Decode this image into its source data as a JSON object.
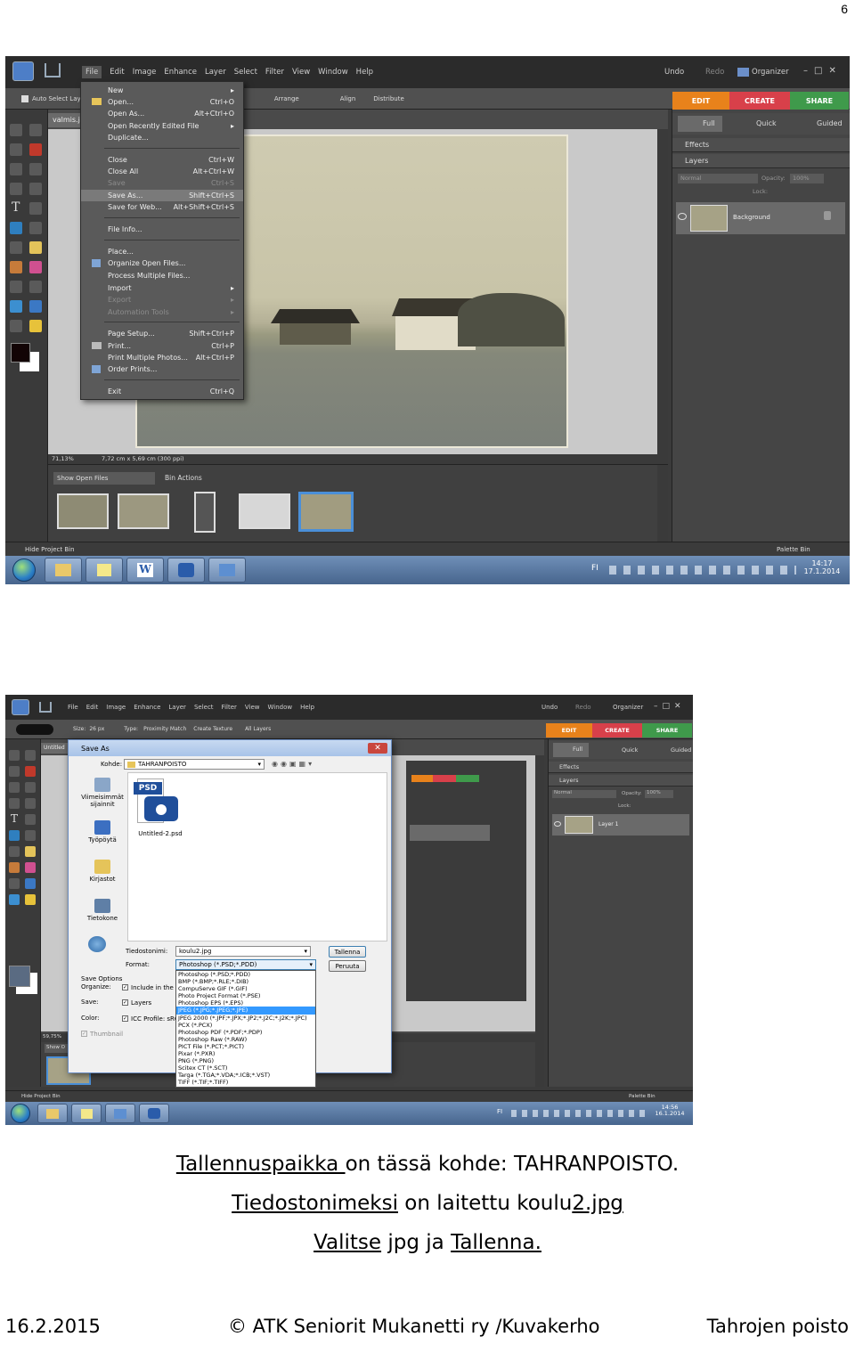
{
  "page_number": "6",
  "colors": {
    "app_bg": "#3b3b3b",
    "edit_tab": "#e8821b",
    "create_tab": "#d8404a",
    "share_tab": "#3f9a4b",
    "highlight": "#3399ff"
  },
  "shot1": {
    "menubar": [
      "File",
      "Edit",
      "Image",
      "Enhance",
      "Layer",
      "Select",
      "Filter",
      "View",
      "Window",
      "Help"
    ],
    "undo": "Undo",
    "redo": "Redo",
    "organizer": "Organizer",
    "options": {
      "auto_select": "Auto Select Layer",
      "arrange": "Arrange",
      "align": "Align",
      "distribute": "Distribute"
    },
    "doc_tab": "valmis.j",
    "tabs": {
      "edit": "EDIT",
      "create": "CREATE",
      "share": "SHARE"
    },
    "subtabs": {
      "full": "Full",
      "quick": "Quick",
      "guided": "Guided"
    },
    "effects": "Effects",
    "layers": "Layers",
    "blend_mode": "Normal",
    "opacity_label": "Opacity:",
    "opacity_value": "100%",
    "lock_label": "Lock:",
    "layer_name": "Background",
    "zoom": "71,13%",
    "doc_info": "7,72 cm x 5,69 cm (300 ppi)",
    "show_open_files": "Show Open Files",
    "bin_actions": "Bin Actions",
    "hide_project_bin": "Hide Project Bin",
    "palette_bin": "Palette Bin",
    "lang": "FI",
    "time": "14:17",
    "date": "17.1.2014",
    "file_menu": [
      {
        "label": "New",
        "shortcut": "",
        "sub": true
      },
      {
        "label": "Open...",
        "shortcut": "Ctrl+O"
      },
      {
        "label": "Open As...",
        "shortcut": "Alt+Ctrl+O"
      },
      {
        "label": "Open Recently Edited File",
        "shortcut": "",
        "sub": true
      },
      {
        "label": "Duplicate...",
        "shortcut": ""
      },
      {
        "label": "Close",
        "shortcut": "Ctrl+W"
      },
      {
        "label": "Close All",
        "shortcut": "Alt+Ctrl+W"
      },
      {
        "label": "Save",
        "shortcut": "Ctrl+S",
        "disabled": true
      },
      {
        "label": "Save As...",
        "shortcut": "Shift+Ctrl+S",
        "highlight": true
      },
      {
        "label": "Save for Web...",
        "shortcut": "Alt+Shift+Ctrl+S"
      },
      {
        "label": "File Info...",
        "shortcut": ""
      },
      {
        "label": "Place...",
        "shortcut": ""
      },
      {
        "label": "Organize Open Files...",
        "shortcut": ""
      },
      {
        "label": "Process Multiple Files...",
        "shortcut": ""
      },
      {
        "label": "Import",
        "shortcut": "",
        "sub": true
      },
      {
        "label": "Export",
        "shortcut": "",
        "disabled": true
      },
      {
        "label": "Automation Tools",
        "shortcut": "",
        "disabled": true
      },
      {
        "label": "Page Setup...",
        "shortcut": "Shift+Ctrl+P"
      },
      {
        "label": "Print...",
        "shortcut": "Ctrl+P"
      },
      {
        "label": "Print Multiple Photos...",
        "shortcut": "Alt+Ctrl+P"
      },
      {
        "label": "Order Prints...",
        "shortcut": ""
      },
      {
        "label": "Exit",
        "shortcut": "Ctrl+Q"
      }
    ]
  },
  "shot2": {
    "menubar": [
      "File",
      "Edit",
      "Image",
      "Enhance",
      "Layer",
      "Select",
      "Filter",
      "View",
      "Window",
      "Help"
    ],
    "undo": "Undo",
    "redo": "Redo",
    "organizer": "Organizer",
    "options": {
      "size_label": "Size:",
      "size_value": "26 px",
      "type_label": "Type:",
      "proximity": "Proximity Match",
      "create_texture": "Create Texture",
      "all_layers": "All Layers"
    },
    "doc_tab": "Untitled",
    "tabs": {
      "edit": "EDIT",
      "create": "CREATE",
      "share": "SHARE"
    },
    "subtabs": {
      "full": "Full",
      "quick": "Quick",
      "guided": "Guided"
    },
    "effects": "Effects",
    "layers": "Layers",
    "blend_mode": "Normal",
    "opacity_label": "Opacity:",
    "opacity_value": "100%",
    "lock_label": "Lock:",
    "layer_name": "Layer 1",
    "zoom": "59,75%",
    "show_open_files": "Show O",
    "hide_project_bin": "Hide Project Bin",
    "palette_bin": "Palette Bin",
    "lang": "FI",
    "time": "14:56",
    "date": "16.1.2014",
    "dialog": {
      "title": "Save As",
      "location_label": "Kohde:",
      "location_value": "TAHRANPOISTO",
      "places": [
        "Viimeisimmät sijainnit",
        "Työpöytä",
        "Kirjastot",
        "Tietokone"
      ],
      "file_badge": "PSD",
      "file_name": "Untitled-2.psd",
      "filename_label": "Tiedostonimi:",
      "filename_value": "koulu2.jpg",
      "format_label": "Format:",
      "format_value": "Photoshop (*.PSD;*.PDD)",
      "save_button": "Tallenna",
      "cancel_button": "Peruuta",
      "save_options": "Save Options",
      "organize_label": "Organize:",
      "include_label": "Include in the O",
      "save_label": "Save:",
      "layers_check": "Layers",
      "color_label": "Color:",
      "icc_label": "ICC Profile:  sRG",
      "thumbnail_label": "Thumbnail",
      "formats": [
        "Photoshop (*.PSD;*.PDD)",
        "BMP (*.BMP;*.RLE;*.DIB)",
        "CompuServe GIF (*.GIF)",
        "Photo Project Format (*.PSE)",
        "Photoshop EPS (*.EPS)",
        "JPEG (*.JPG;*.JPEG;*.JPE)",
        "JPEG 2000 (*.JPF;*.JPX;*.JP2;*.J2C;*.J2K;*.JPC)",
        "PCX (*.PCX)",
        "Photoshop PDF (*.PDF;*.PDP)",
        "Photoshop Raw (*.RAW)",
        "PICT File (*.PCT;*.PICT)",
        "Pixar (*.PXR)",
        "PNG (*.PNG)",
        "Scitex CT (*.SCT)",
        "Targa (*.TGA;*.VDA;*.ICB;*.VST)",
        "TIFF (*.TIF;*.TIFF)"
      ]
    }
  },
  "caption": {
    "line1_a": "Tallennuspaikka ",
    "line1_b": "on tässä kohde: TAHRANPOISTO.",
    "line2_a": "Tiedostonimeksi",
    "line2_b": " on laitettu koulu",
    "line2_c": "2.jpg",
    "line3_a": "Valitse",
    "line3_b": " jpg ja ",
    "line3_c": "Tallenna."
  },
  "footer": {
    "date": "16.2.2015",
    "copyright": "© ATK Seniorit Mukanetti ry /Kuvakerho",
    "topic": "Tahrojen poisto"
  }
}
